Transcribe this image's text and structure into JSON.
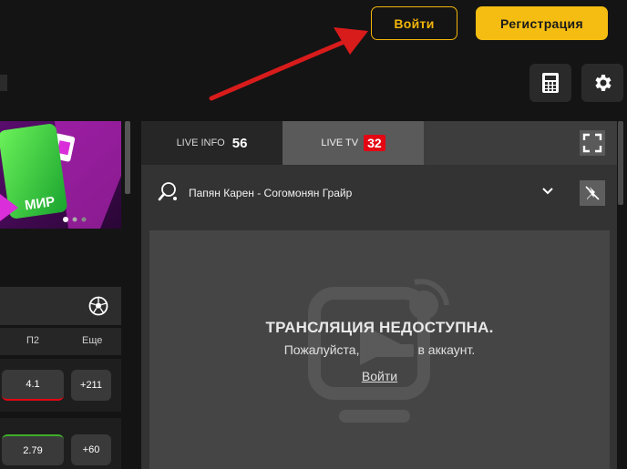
{
  "header": {
    "login_label": "Войти",
    "register_label": "Регистрация"
  },
  "toolbar": {
    "calculator_icon": "calculator-icon",
    "settings_icon": "gear-icon"
  },
  "promo": {
    "card_text": "МИР"
  },
  "odds_table": {
    "columns": [
      "П2",
      "Еще"
    ],
    "rows": [
      {
        "p2": "4.1",
        "more": "+211",
        "accent": "#e30613"
      },
      {
        "p2": "2.79",
        "more": "+60",
        "accent": "#3fae29"
      }
    ]
  },
  "live_panel": {
    "tab_info_label": "LIVE INFO",
    "tab_info_count": "56",
    "tab_tv_label": "LIVE TV",
    "tab_tv_count": "32",
    "match_title": "Папян Карен - Согомонян Грайр",
    "unavailable_title": "ТРАНСЛЯЦИЯ НЕДОСТУПНА.",
    "unavailable_before": "Пожалуйста,",
    "unavailable_after": "в аккаунт.",
    "login_link": "Войти"
  },
  "colors": {
    "accent_yellow": "#f5bd12",
    "live_badge": "#e30613",
    "annotation_arrow": "#d81b1b"
  }
}
